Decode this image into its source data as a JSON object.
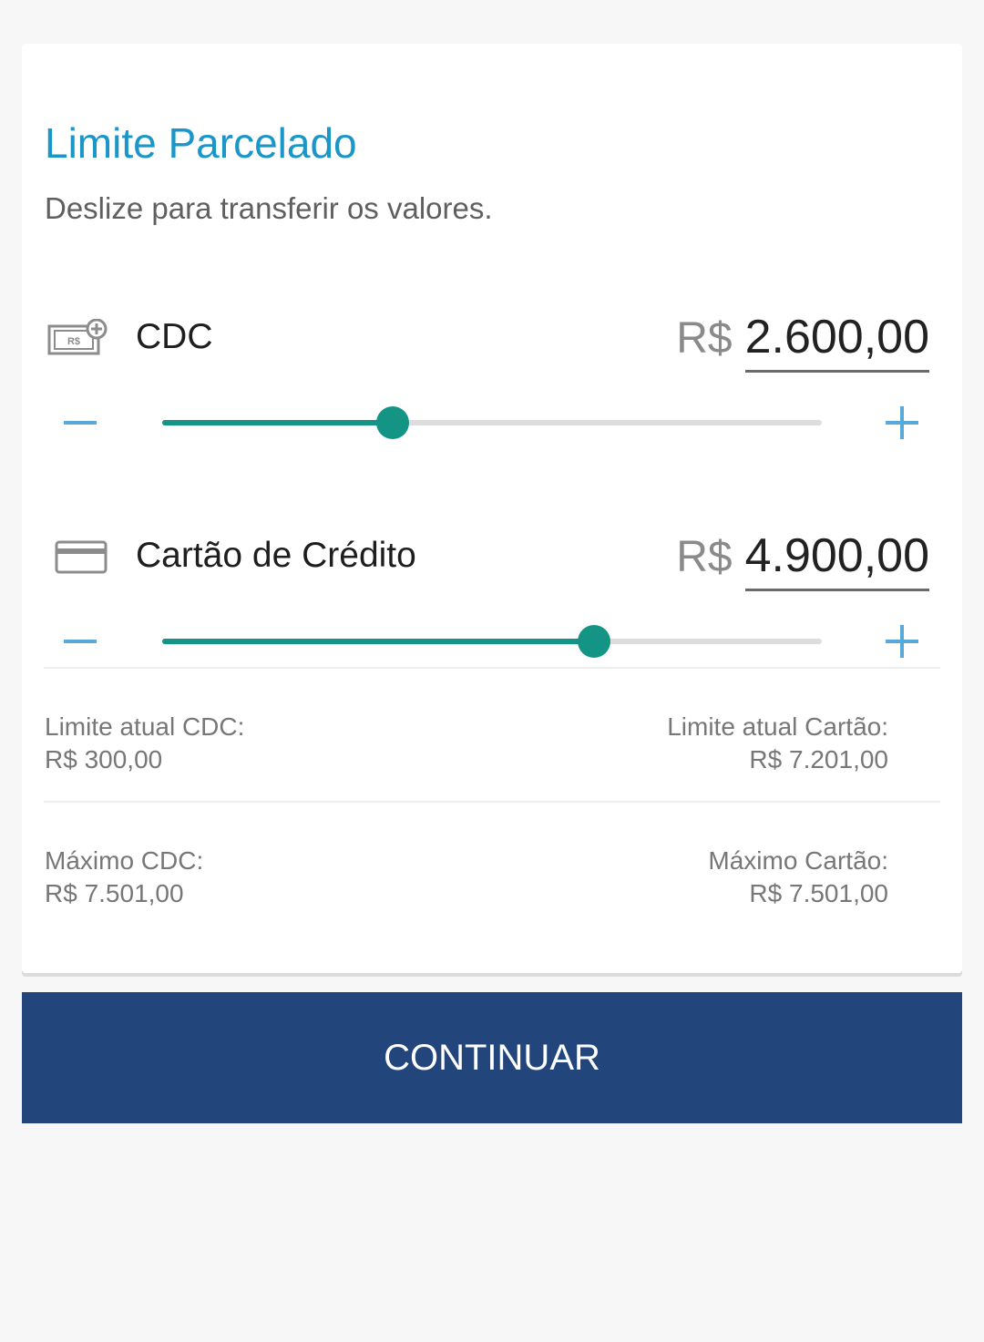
{
  "header": {
    "title": "Limite Parcelado",
    "subtitle": "Deslize para transferir os valores."
  },
  "rows": [
    {
      "icon": "money-add-icon",
      "label": "CDC",
      "currency": "R$",
      "value": "2.600,00",
      "slider_fraction": 0.35
    },
    {
      "icon": "credit-card-icon",
      "label": "Cartão de Crédito",
      "currency": "R$",
      "value": "4.900,00",
      "slider_fraction": 0.655
    }
  ],
  "info": {
    "current_cdc_label": "Limite atual CDC:",
    "current_cdc_value": "R$ 300,00",
    "current_card_label": "Limite atual Cartão:",
    "current_card_value": "R$ 7.201,00",
    "max_cdc_label": "Máximo CDC:",
    "max_cdc_value": "R$ 7.501,00",
    "max_card_label": "Máximo Cartão:",
    "max_card_value": "R$ 7.501,00"
  },
  "actions": {
    "continue_label": "CONTINUAR"
  },
  "colors": {
    "title": "#1a96c8",
    "slider": "#149484",
    "stepper": "#58a9d8",
    "button": "#22457c",
    "icon_badge_text": "R$"
  }
}
